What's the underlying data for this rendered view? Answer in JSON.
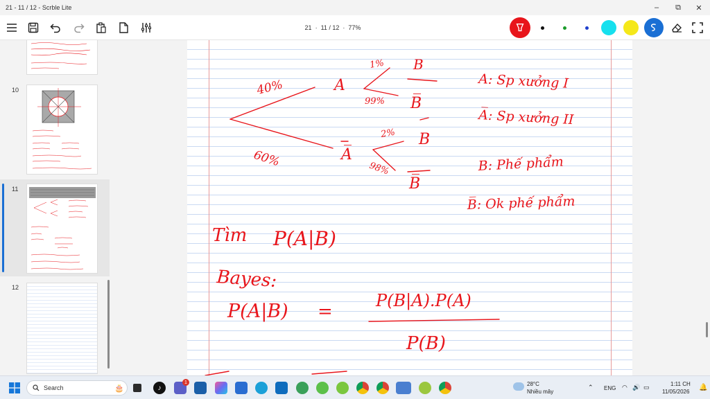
{
  "window": {
    "title": "21 - 11 / 12 - Scrble Lite",
    "controls": {
      "minimize": "–",
      "maximize": "⧉",
      "close": "✕"
    }
  },
  "toolbar": {
    "page_info": {
      "notebook": "21",
      "page": "11 / 12",
      "zoom": "77%",
      "separator": "·"
    },
    "buttons": [
      "menu-icon",
      "save-icon",
      "undo-icon",
      "redo-icon",
      "clipboard-icon",
      "page-icon",
      "sliders-icon",
      "pen-icon",
      "eraser-icon",
      "select-icon"
    ],
    "colors": {
      "pen_active": "#e8151b",
      "black": "#111111",
      "green": "#1a9b2a",
      "blue": "#1f3fcc",
      "cyan": "#16e0ee",
      "yellow": "#f5e81a",
      "lasso_blue": "#1a6fd4"
    }
  },
  "sidebar": {
    "pages": [
      {
        "number": "",
        "kind": "partial"
      },
      {
        "number": "10",
        "kind": "diagram"
      },
      {
        "number": "11",
        "kind": "notes",
        "selected": true
      },
      {
        "number": "12",
        "kind": "blank"
      }
    ]
  },
  "canvas": {
    "ink_color": "#e8151b",
    "notes": {
      "branch_left": "40%",
      "branch_right": "60%",
      "node_a": "A",
      "node_abar": "A̅",
      "p_b_given_a": "1%",
      "p_bbar_given_a": "99%",
      "p_b_given_abar": "2%",
      "p_bbar_given_abar": "98%",
      "leaf_b": "B",
      "leaf_bbar": "B̅",
      "legend_a": "A: Sp xưởng I",
      "legend_abar": "A̅: Sp xưởng II",
      "legend_b": "B: Phế phẩm",
      "legend_bbar": "B̅: Ok phế phẩm",
      "find_label": "Tìm",
      "find_expr": "P(A|B)",
      "bayes_label": "Bayes:",
      "bayes_lhs": "P(A|B)",
      "equals": "=",
      "numerator": "P(B|A).P(A)",
      "denominator": "P(B)"
    }
  },
  "taskbar": {
    "search_placeholder": "Search",
    "weather_temp": "28°C",
    "weather_desc": "Nhiều mây",
    "language": "ENG",
    "time": "1:11 CH",
    "date": "11/05/2026",
    "notification_badge": "1"
  }
}
